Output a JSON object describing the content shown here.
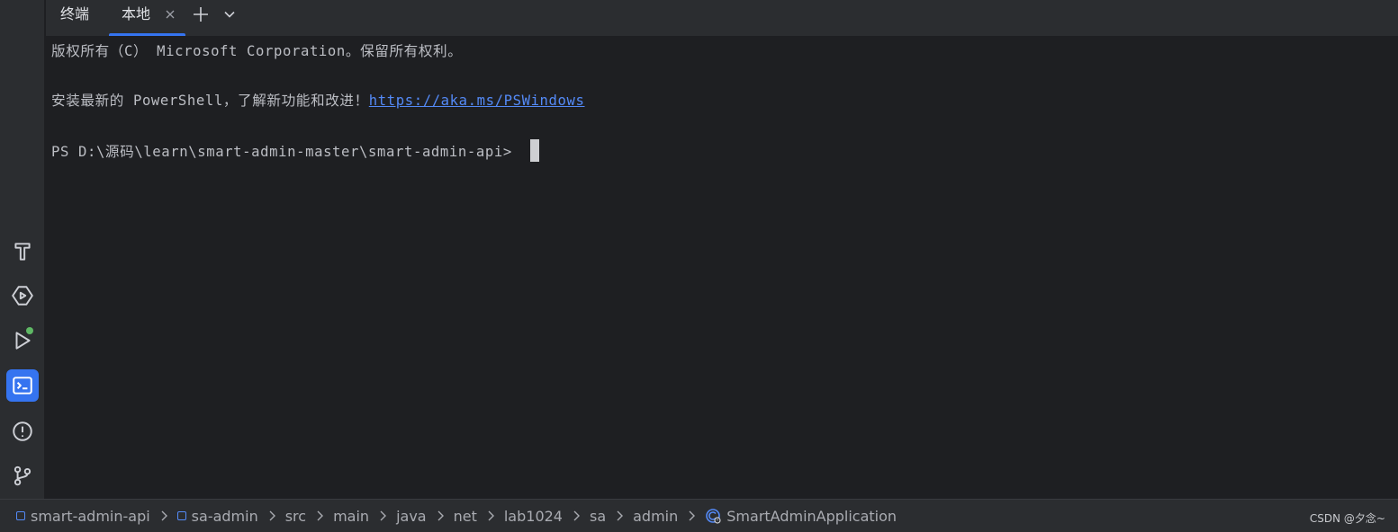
{
  "sidebar": {
    "icons": [
      {
        "name": "build-hammer-icon"
      },
      {
        "name": "services-icon"
      },
      {
        "name": "run-icon"
      },
      {
        "name": "terminal-icon"
      },
      {
        "name": "problems-icon"
      },
      {
        "name": "git-branch-icon"
      }
    ],
    "accent": "#3574f0",
    "run_status_color": "#5fb865"
  },
  "tabbar": {
    "title": "终端",
    "active_tab": "本地"
  },
  "terminal": {
    "copyright_line": "版权所有（C） Microsoft Corporation。保留所有权利。",
    "install_text": "安装最新的 PowerShell，了解新功能和改进！",
    "install_link": "https://aka.ms/PSWindows",
    "prompt": "PS D:\\源码\\learn\\smart-admin-master\\smart-admin-api> "
  },
  "statusbar": {
    "breadcrumbs": [
      {
        "label": "smart-admin-api",
        "icon": "module-icon"
      },
      {
        "label": "sa-admin",
        "icon": "module-icon"
      },
      {
        "label": "src"
      },
      {
        "label": "main"
      },
      {
        "label": "java"
      },
      {
        "label": "net"
      },
      {
        "label": "lab1024"
      },
      {
        "label": "sa"
      },
      {
        "label": "admin"
      },
      {
        "label": "SmartAdminApplication",
        "icon": "spring-class-icon"
      }
    ],
    "watermark": "CSDN @夕念~"
  }
}
